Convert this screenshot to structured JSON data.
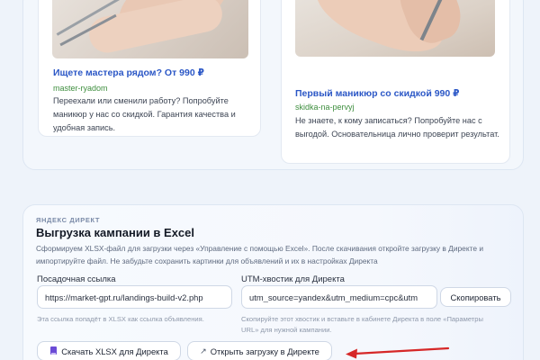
{
  "ads": [
    {
      "title": "Ищете мастера рядом? От 990 ₽",
      "domain": "master-ryadom",
      "text": "Переехали или сменили работу? Попробуйте маникюр у нас со скидкой. Гарантия качества и удобная запись."
    },
    {
      "title": "Первый маникюр со скидкой 990 ₽",
      "domain": "skidka-na-pervyj",
      "text": "Не знаете, к кому записаться? Попробуйте нас с выгодой. Основательница лично проверит результат."
    }
  ],
  "export": {
    "eyebrow": "ЯНДЕКС ДИРЕКТ",
    "title": "Выгрузка кампании в Excel",
    "description": "Сформируем XLSX-файл для загрузки через «Управление с помощью Excel». После скачивания откройте загрузку в Директе и импортируйте файл. Не забудьте сохранить картинки для объявлений и их в настройках Директа",
    "landing_label": "Посадочная ссылка",
    "landing_value": "https://market-gpt.ru/landings-build-v2.php",
    "landing_hint": "Эта ссылка попадёт в XLSX как ссылка объявления.",
    "utm_label": "UTM-хвостик для Директа",
    "utm_value": "utm_source=yandex&utm_medium=cpc&utm",
    "copy_button": "Скопировать",
    "utm_hint": "Скопируйте этот хвостик и вставьте в кабинете Директа в поле «Параметры URL» для нужной кампании.",
    "download_button": "Скачать XLSX для Директа",
    "open_button": "Открыть загрузку в Директе",
    "open_icon": "↗"
  },
  "colors": {
    "link": "#2b57c6",
    "domain": "#3e8e3e",
    "annotation_arrow": "#d62828"
  }
}
